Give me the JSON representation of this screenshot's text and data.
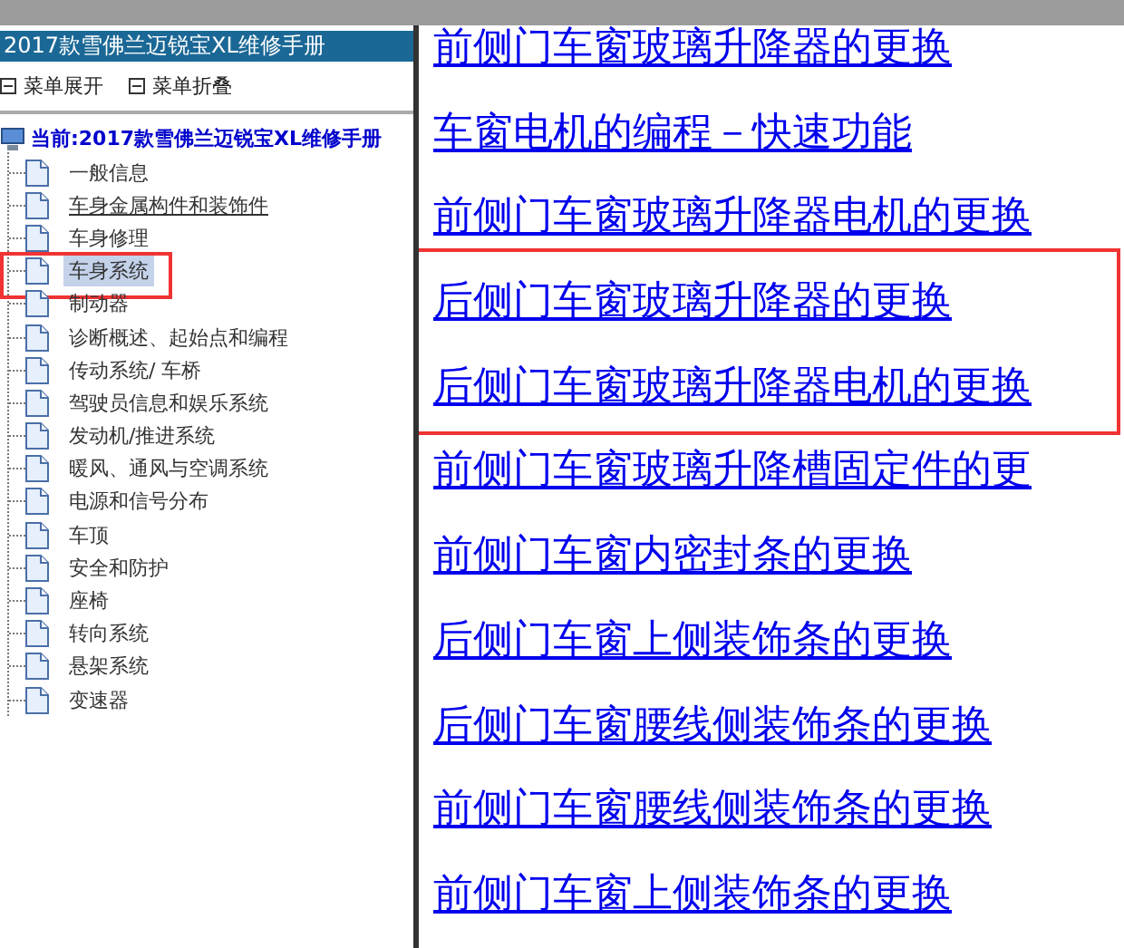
{
  "sidebar": {
    "title": "2017款雪佛兰迈锐宝XL维修手册",
    "menu": [
      {
        "label": "菜单展开"
      },
      {
        "label": "菜单折叠"
      }
    ],
    "root": {
      "label": "当前:2017款雪佛兰迈锐宝XL维修手册",
      "children": [
        {
          "label": "一般信息",
          "selected": false,
          "hovered": false,
          "annotated": false
        },
        {
          "label": "车身金属构件和装饰件",
          "selected": false,
          "hovered": true,
          "annotated": false
        },
        {
          "label": "车身修理",
          "selected": false,
          "hovered": false,
          "annotated": false
        },
        {
          "label": "车身系统",
          "selected": true,
          "hovered": false,
          "annotated": true
        },
        {
          "label": "制动器",
          "selected": false,
          "hovered": false,
          "annotated": false
        },
        {
          "label": "诊断概述、起始点和编程",
          "selected": false,
          "hovered": false,
          "annotated": false
        },
        {
          "label": "传动系统/ 车桥",
          "selected": false,
          "hovered": false,
          "annotated": false
        },
        {
          "label": "驾驶员信息和娱乐系统",
          "selected": false,
          "hovered": false,
          "annotated": false
        },
        {
          "label": "发动机/推进系统",
          "selected": false,
          "hovered": false,
          "annotated": false
        },
        {
          "label": "暖风、通风与空调系统",
          "selected": false,
          "hovered": false,
          "annotated": false
        },
        {
          "label": "电源和信号分布",
          "selected": false,
          "hovered": false,
          "annotated": false
        },
        {
          "label": "车顶",
          "selected": false,
          "hovered": false,
          "annotated": false
        },
        {
          "label": "安全和防护",
          "selected": false,
          "hovered": false,
          "annotated": false
        },
        {
          "label": "座椅",
          "selected": false,
          "hovered": false,
          "annotated": false
        },
        {
          "label": "转向系统",
          "selected": false,
          "hovered": false,
          "annotated": false
        },
        {
          "label": "悬架系统",
          "selected": false,
          "hovered": false,
          "annotated": false
        },
        {
          "label": "变速器",
          "selected": false,
          "hovered": false,
          "annotated": false
        }
      ]
    }
  },
  "links": [
    {
      "label": "前侧门车窗玻璃升降器的更换",
      "annotated": false
    },
    {
      "label": "车窗电机的编程－快速功能",
      "annotated": false
    },
    {
      "label": "前侧门车窗玻璃升降器电机的更换",
      "annotated": false
    },
    {
      "label": "后侧门车窗玻璃升降器的更换",
      "annotated": true
    },
    {
      "label": "后侧门车窗玻璃升降器电机的更换",
      "annotated": true
    },
    {
      "label": "前侧门车窗玻璃升降槽固定件的更",
      "annotated": false
    },
    {
      "label": "前侧门车窗内密封条的更换",
      "annotated": false
    },
    {
      "label": "后侧门车窗上侧装饰条的更换",
      "annotated": false
    },
    {
      "label": "后侧门车窗腰线侧装饰条的更换",
      "annotated": false
    },
    {
      "label": "前侧门车窗腰线侧装饰条的更换",
      "annotated": false
    },
    {
      "label": "前侧门车窗上侧装饰条的更换",
      "annotated": false
    }
  ]
}
